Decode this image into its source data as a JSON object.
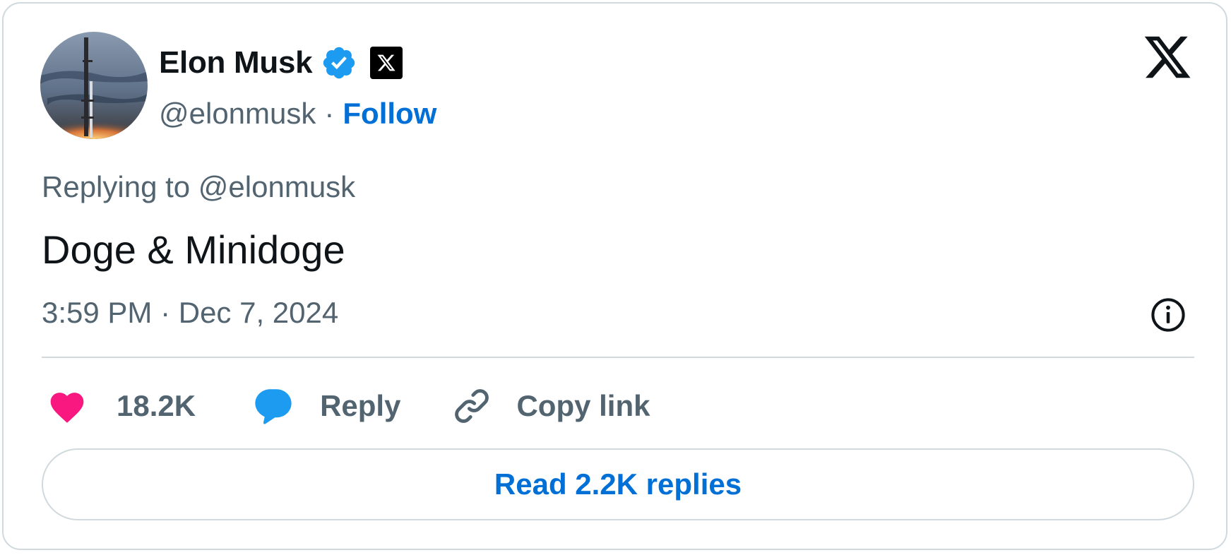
{
  "author": {
    "name": "Elon Musk",
    "handle": "@elonmusk",
    "separator": "·",
    "follow_label": "Follow"
  },
  "tweet": {
    "replying_to": "Replying to @elonmusk",
    "text": "Doge & Minidoge",
    "timestamp": "3:59 PM · Dec 7, 2024"
  },
  "actions": {
    "likes": "18.2K",
    "reply_label": "Reply",
    "copy_link_label": "Copy link",
    "read_replies_label": "Read 2.2K replies"
  },
  "icons": {
    "verified": "verified-badge-icon",
    "affiliate": "x-affiliate-badge-icon",
    "brand": "x-logo-icon",
    "info": "info-icon",
    "like": "heart-icon",
    "reply": "speech-bubble-icon",
    "copy_link": "link-icon"
  },
  "colors": {
    "text_primary": "#0f1419",
    "text_secondary": "#536471",
    "link_blue": "#006fd6",
    "verified_blue": "#1d9bf0",
    "like_pink": "#f91880",
    "border": "#cfd9de"
  }
}
